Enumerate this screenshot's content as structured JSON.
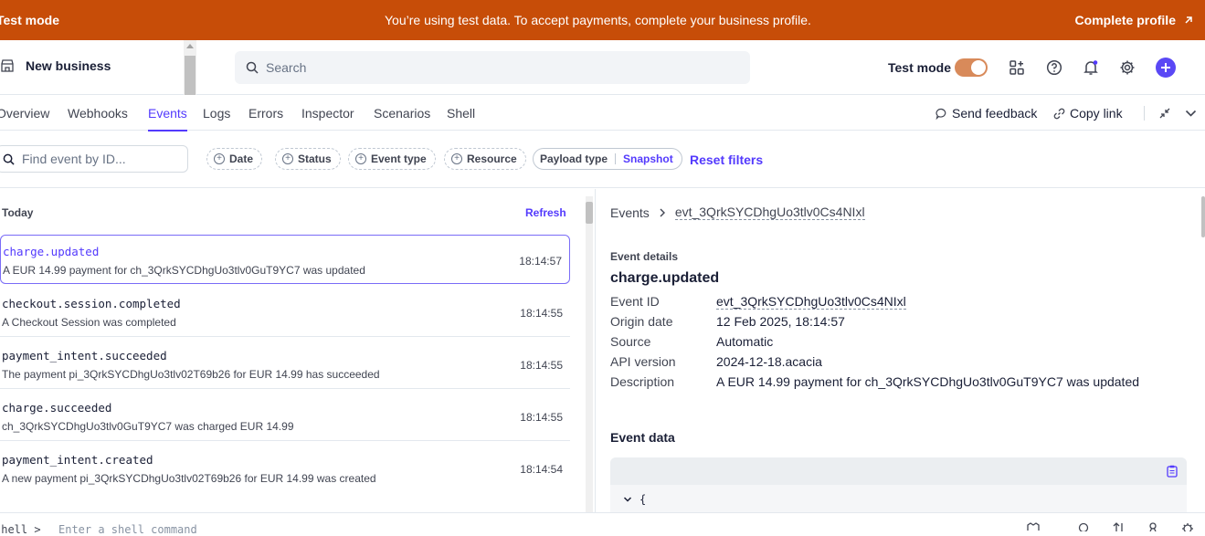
{
  "banner": {
    "mode_label": "Test mode",
    "message": "You’re using test data. To accept payments, complete your business profile.",
    "cta": "Complete profile"
  },
  "topbar": {
    "business_name": "New business",
    "search_placeholder": "Search",
    "test_mode_label": "Test mode"
  },
  "tabs": [
    "Overview",
    "Webhooks",
    "Events",
    "Logs",
    "Errors",
    "Inspector",
    "Scenarios",
    "Shell"
  ],
  "tab_actions": {
    "feedback": "Send feedback",
    "copy_link": "Copy link"
  },
  "filters": {
    "find_placeholder": "Find event by ID...",
    "date": "Date",
    "status": "Status",
    "event_type": "Event type",
    "resource": "Resource",
    "payload_label": "Payload type",
    "payload_value": "Snapshot",
    "reset": "Reset filters"
  },
  "events_list": {
    "group_label": "Today",
    "refresh": "Refresh",
    "items": [
      {
        "name": "charge.updated",
        "desc": "A EUR 14.99 payment for ch_3QrkSYCDhgUo3tlv0GuT9YC7 was updated",
        "time": "18:14:57"
      },
      {
        "name": "checkout.session.completed",
        "desc": "A Checkout Session was completed",
        "time": "18:14:55"
      },
      {
        "name": "payment_intent.succeeded",
        "desc": "The payment pi_3QrkSYCDhgUo3tlv02T69b26 for EUR 14.99 has succeeded",
        "time": "18:14:55"
      },
      {
        "name": "charge.succeeded",
        "desc": "ch_3QrkSYCDhgUo3tlv0GuT9YC7 was charged EUR 14.99",
        "time": "18:14:55"
      },
      {
        "name": "payment_intent.created",
        "desc": "A new payment pi_3QrkSYCDhgUo3tlv02T69b26 for EUR 14.99 was created",
        "time": "18:14:54"
      }
    ]
  },
  "detail": {
    "crumb_root": "Events",
    "crumb_id": "evt_3QrkSYCDhgUo3tlv0Cs4NIxl",
    "section": "Event details",
    "title": "charge.updated",
    "fields": [
      {
        "label": "Event ID",
        "value": "evt_3QrkSYCDhgUo3tlv0Cs4NIxl"
      },
      {
        "label": "Origin date",
        "value": "12 Feb 2025, 18:14:57"
      },
      {
        "label": "Source",
        "value": "Automatic"
      },
      {
        "label": "API version",
        "value": "2024-12-18.acacia"
      },
      {
        "label": "Description",
        "value": "A EUR 14.99 payment for ch_3QrkSYCDhgUo3tlv0GuT9YC7 was updated"
      }
    ],
    "event_data_label": "Event data",
    "code_first_line": "{"
  },
  "shell": {
    "prompt": "shell >",
    "placeholder": "Enter a shell command"
  },
  "colors": {
    "banner": "#c74d08",
    "accent": "#533afd"
  }
}
